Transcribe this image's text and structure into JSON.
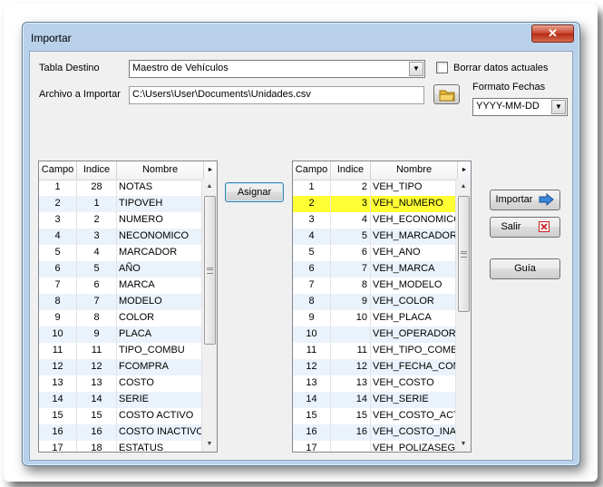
{
  "window": {
    "title": "Importar",
    "close_glyph": "✕"
  },
  "form": {
    "tabla_destino_label": "Tabla Destino",
    "tabla_destino_value": "Maestro de Vehículos",
    "borrar_label": "Borrar datos actuales",
    "borrar_checked": false,
    "archivo_label": "Archivo a Importar",
    "archivo_value": "C:\\Users\\User\\Documents\\Unidades.csv",
    "formato_label": "Formato Fechas",
    "formato_value": "YYYY-MM-DD"
  },
  "buttons": {
    "asignar": "Asignar",
    "importar": "Importar",
    "salir": "Salir",
    "guia": "Guía"
  },
  "left_grid": {
    "headers": [
      "Campo",
      "Indice",
      "Nombre"
    ],
    "rows": [
      [
        "1",
        "28",
        "NOTAS"
      ],
      [
        "2",
        "1",
        "TIPOVEH"
      ],
      [
        "3",
        "2",
        "NUMERO"
      ],
      [
        "4",
        "3",
        "NECONOMICO"
      ],
      [
        "5",
        "4",
        "MARCADOR"
      ],
      [
        "6",
        "5",
        "AÑO"
      ],
      [
        "7",
        "6",
        "MARCA"
      ],
      [
        "8",
        "7",
        "MODELO"
      ],
      [
        "9",
        "8",
        "COLOR"
      ],
      [
        "10",
        "9",
        "PLACA"
      ],
      [
        "11",
        "11",
        "TIPO_COMBU"
      ],
      [
        "12",
        "12",
        "FCOMPRA"
      ],
      [
        "13",
        "13",
        "COSTO"
      ],
      [
        "14",
        "14",
        "SERIE"
      ],
      [
        "15",
        "15",
        "COSTO ACTIVO"
      ],
      [
        "16",
        "16",
        "COSTO INACTIVO"
      ],
      [
        "17",
        "18",
        "ESTATUS"
      ]
    ]
  },
  "right_grid": {
    "headers": [
      "Campo",
      "Indice",
      "Nombre"
    ],
    "selected_row": 1,
    "rows": [
      [
        "1",
        "2",
        "VEH_TIPO"
      ],
      [
        "2",
        "3",
        "VEH_NUMERO"
      ],
      [
        "3",
        "4",
        "VEH_ECONOMICO"
      ],
      [
        "4",
        "5",
        "VEH_MARCADOR"
      ],
      [
        "5",
        "6",
        "VEH_ANO"
      ],
      [
        "6",
        "7",
        "VEH_MARCA"
      ],
      [
        "7",
        "8",
        "VEH_MODELO"
      ],
      [
        "8",
        "9",
        "VEH_COLOR"
      ],
      [
        "9",
        "10",
        "VEH_PLACA"
      ],
      [
        "10",
        "",
        "VEH_OPERADOR"
      ],
      [
        "11",
        "11",
        "VEH_TIPO_COMBU"
      ],
      [
        "12",
        "12",
        "VEH_FECHA_COMI"
      ],
      [
        "13",
        "13",
        "VEH_COSTO"
      ],
      [
        "14",
        "14",
        "VEH_SERIE"
      ],
      [
        "15",
        "15",
        "VEH_COSTO_ACTI"
      ],
      [
        "16",
        "16",
        "VEH_COSTO_INAC"
      ],
      [
        "17",
        "",
        "VEH_POLIZASEGU"
      ]
    ]
  },
  "icons": {
    "dropdown": "▼",
    "scroll_up": "▲",
    "scroll_down": "▼",
    "header_more": "►",
    "folder": "folder-icon",
    "importar_arrow": "arrow-right-icon",
    "salir_x": "red-x-icon"
  },
  "colors": {
    "selected_row": "#ffff33",
    "alt_row": "#eaf2fb",
    "close_red": "#c7432a"
  }
}
